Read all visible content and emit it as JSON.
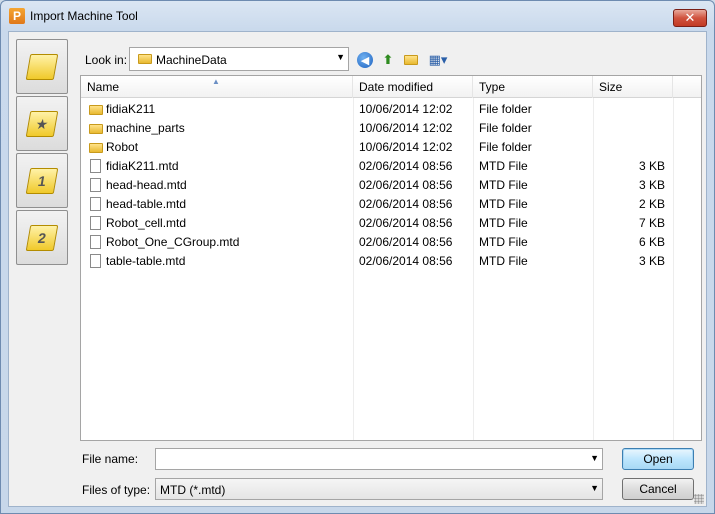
{
  "window": {
    "title": "Import Machine Tool",
    "app_icon": "P",
    "close_glyph": "✕"
  },
  "places": [
    {
      "icon": "recent-places-icon",
      "glyph": ""
    },
    {
      "icon": "favorites-folder-icon",
      "glyph": "★"
    },
    {
      "icon": "folder-1-icon",
      "glyph": "1"
    },
    {
      "icon": "folder-2-icon",
      "glyph": "2"
    }
  ],
  "toolbar": {
    "look_in_label": "Look in:",
    "look_in_value": "MachineData",
    "back_glyph": "◀",
    "up_glyph": "⬆",
    "new_folder_glyph": "✦",
    "view_glyph": "▦▾"
  },
  "columns": {
    "name": "Name",
    "date": "Date modified",
    "type": "Type",
    "size": "Size",
    "sort_glyph": "▲"
  },
  "files": [
    {
      "name": "fidiaK211",
      "date": "10/06/2014 12:02",
      "type": "File folder",
      "size": "",
      "kind": "folder"
    },
    {
      "name": "machine_parts",
      "date": "10/06/2014 12:02",
      "type": "File folder",
      "size": "",
      "kind": "folder"
    },
    {
      "name": "Robot",
      "date": "10/06/2014 12:02",
      "type": "File folder",
      "size": "",
      "kind": "folder"
    },
    {
      "name": "fidiaK211.mtd",
      "date": "02/06/2014 08:56",
      "type": "MTD File",
      "size": "3 KB",
      "kind": "file"
    },
    {
      "name": "head-head.mtd",
      "date": "02/06/2014 08:56",
      "type": "MTD File",
      "size": "3 KB",
      "kind": "file"
    },
    {
      "name": "head-table.mtd",
      "date": "02/06/2014 08:56",
      "type": "MTD File",
      "size": "2 KB",
      "kind": "file"
    },
    {
      "name": "Robot_cell.mtd",
      "date": "02/06/2014 08:56",
      "type": "MTD File",
      "size": "7 KB",
      "kind": "file"
    },
    {
      "name": "Robot_One_CGroup.mtd",
      "date": "02/06/2014 08:56",
      "type": "MTD File",
      "size": "6 KB",
      "kind": "file"
    },
    {
      "name": "table-table.mtd",
      "date": "02/06/2014 08:56",
      "type": "MTD File",
      "size": "3 KB",
      "kind": "file"
    }
  ],
  "bottom": {
    "file_name_label": "File name:",
    "file_name_value": "",
    "file_type_label": "Files of type:",
    "file_type_value": "MTD (*.mtd)",
    "open_label": "Open",
    "cancel_label": "Cancel",
    "dropdown_glyph": "▼"
  }
}
